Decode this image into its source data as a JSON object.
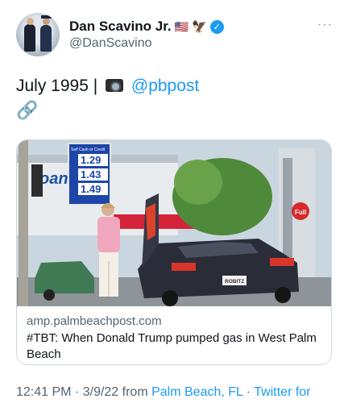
{
  "author": {
    "display_name": "Dan Scavino Jr.",
    "flag_emoji": "🇺🇸",
    "eagle_emoji": "🦅",
    "handle": "@DanScavino",
    "verified_icon": "verified-badge"
  },
  "menu": {
    "more_label": "···"
  },
  "tweet": {
    "text_prefix": "July 1995 |",
    "mention": "@pbpost",
    "link_icon": "🔗"
  },
  "card": {
    "domain": "amp.palmbeachpost.com",
    "title": "#TBT: When Donald Trump pumped gas in West Palm Beach",
    "photo": {
      "sign_header": "Self  Cash or Credit",
      "prices": [
        "1.29",
        "1.43",
        "1.49"
      ],
      "pump_label": "Full",
      "plate_text": "ROBITZ",
      "store_sign": "oan",
      "car_color": "#2a2c38"
    }
  },
  "footer": {
    "time": "12:41 PM",
    "date": "3/9/22",
    "from_label": "from",
    "location": "Palm Beach, FL",
    "source": "Twitter for"
  },
  "colors": {
    "accent": "#1d9bf0",
    "text": "#0f1419",
    "muted": "#536471",
    "border": "#cfd9de"
  }
}
